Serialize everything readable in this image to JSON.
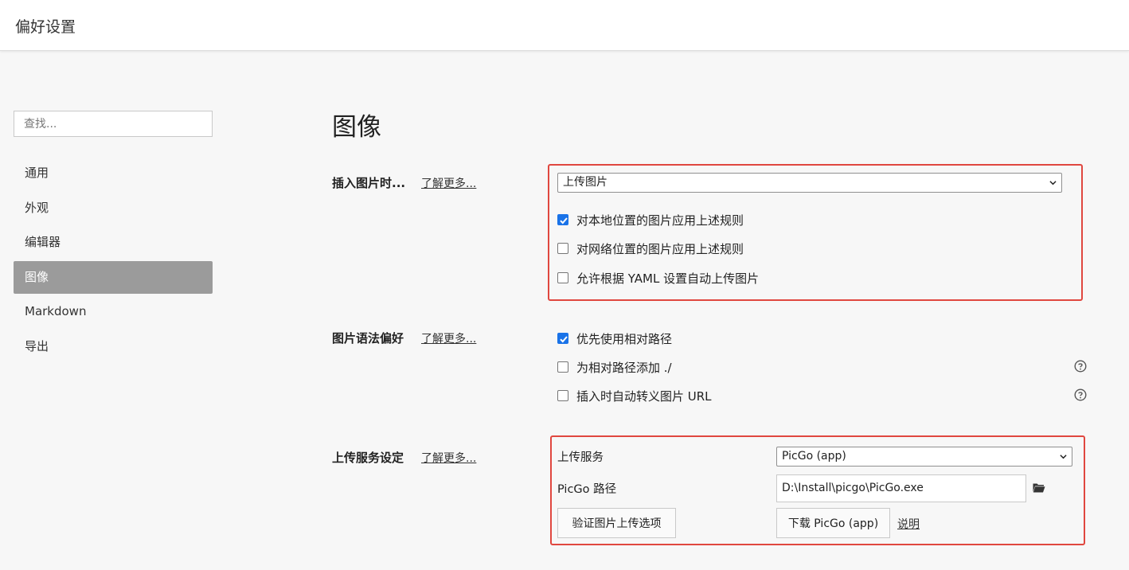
{
  "window": {
    "title": "偏好设置"
  },
  "sidebar": {
    "search_placeholder": "查找...",
    "items": [
      {
        "label": "通用"
      },
      {
        "label": "外观"
      },
      {
        "label": "编辑器"
      },
      {
        "label": "图像"
      },
      {
        "label": "Markdown"
      },
      {
        "label": "导出"
      }
    ],
    "active_index": 3
  },
  "main": {
    "title": "图像",
    "learn_more": "了解更多...",
    "insert": {
      "label": "插入图片时...",
      "select_value": "上传图片",
      "options": [
        {
          "label": "对本地位置的图片应用上述规则",
          "checked": true
        },
        {
          "label": "对网络位置的图片应用上述规则",
          "checked": false
        },
        {
          "label": "允许根据 YAML 设置自动上传图片",
          "checked": false
        }
      ]
    },
    "syntax": {
      "label": "图片语法偏好",
      "options": [
        {
          "label": "优先使用相对路径",
          "checked": true
        },
        {
          "label": "为相对路径添加 ./",
          "checked": false
        },
        {
          "label": "插入时自动转义图片 URL",
          "checked": false
        }
      ]
    },
    "upload": {
      "label": "上传服务设定",
      "service_label": "上传服务",
      "service_value": "PicGo (app)",
      "path_label": "PicGo 路径",
      "path_value": "D:\\Install\\picgo\\PicGo.exe",
      "verify_button": "验证图片上传选项",
      "download_button": "下载 PicGo (app)",
      "explain_link": "说明"
    }
  },
  "colors": {
    "accent": "#1a73e8",
    "highlight_border": "#e0473f",
    "sidebar_active": "#9b9b9b"
  }
}
